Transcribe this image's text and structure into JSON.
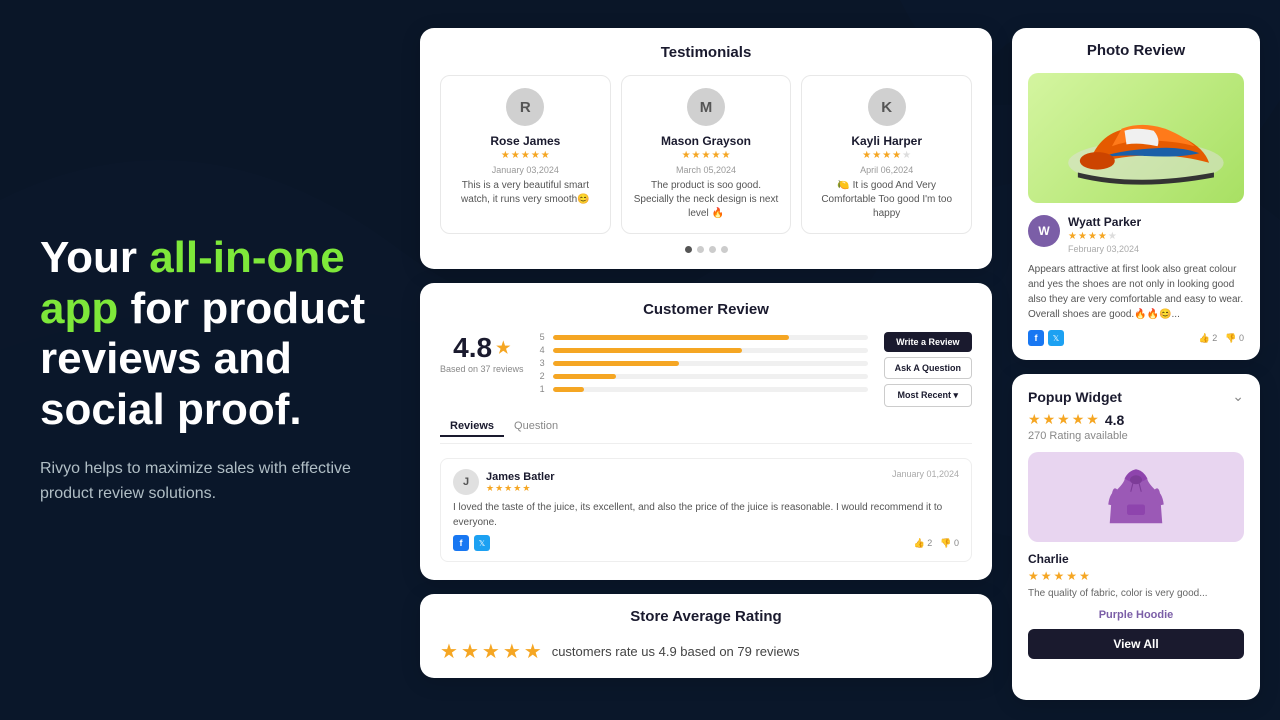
{
  "hero": {
    "title_part1": "Your ",
    "title_highlight": "all-in-one app",
    "title_part2": " for product reviews and social proof.",
    "subtitle": "Rivyo helps to maximize sales with effective product review solutions."
  },
  "testimonials": {
    "title": "Testimonials",
    "reviews": [
      {
        "initial": "R",
        "name": "Rose James",
        "date": "January 03,2024",
        "stars": 5,
        "text": "This is a very beautiful smart watch, it runs very smooth😊"
      },
      {
        "initial": "M",
        "name": "Mason Grayson",
        "date": "March 05,2024",
        "stars": 5,
        "text": "The product is soo good. Specially the neck design is next level 🔥"
      },
      {
        "initial": "K",
        "name": "Kayli Harper",
        "date": "April 06,2024",
        "stars": 4,
        "text": "🍋 It is good And Very Comfortable Too good I'm too happy"
      }
    ]
  },
  "customer_review": {
    "title": "Customer Review",
    "rating": "4.8",
    "based_on": "Based on 37 reviews",
    "bars": [
      {
        "label": "5",
        "pct": 75
      },
      {
        "label": "4",
        "pct": 60
      },
      {
        "label": "3",
        "pct": 40
      },
      {
        "label": "2",
        "pct": 20
      },
      {
        "label": "1",
        "pct": 10
      }
    ],
    "buttons": {
      "write_review": "Write a Review",
      "ask_question": "Ask A Question",
      "most_recent": "Most Recent ▾"
    },
    "tabs": [
      "Reviews",
      "Question"
    ],
    "review_item": {
      "initial": "J",
      "name": "James Batler",
      "date": "January 01,2024",
      "stars": 5,
      "text": "I loved the taste of the juice, its excellent, and also the price of the juice is reasonable. I would recommend it to everyone.",
      "likes": "2",
      "dislikes": "0"
    }
  },
  "store_rating": {
    "title": "Store Average Rating",
    "stars": 5,
    "text": "customers rate us 4.9 based on 79 reviews"
  },
  "photo_review": {
    "title": "Photo Review",
    "reviewer": {
      "initial": "W",
      "name": "Wyatt Parker",
      "date": "February 03,2024",
      "stars": 4,
      "text": "Appears attractive at first look also great colour and yes the shoes are not only in looking good also they are very comfortable and easy to wear. Overall shoes are good.🔥🔥😊..."
    },
    "likes": "2",
    "dislikes": "0"
  },
  "popup_widget": {
    "title": "Popup Widget",
    "rating": "4.8",
    "count": "270 Rating available",
    "reviewer": {
      "name": "Charlie",
      "stars": 5,
      "text": "The quality of fabric, color is very good..."
    },
    "product_link": "Purple Hoodie",
    "view_button": "View All"
  }
}
